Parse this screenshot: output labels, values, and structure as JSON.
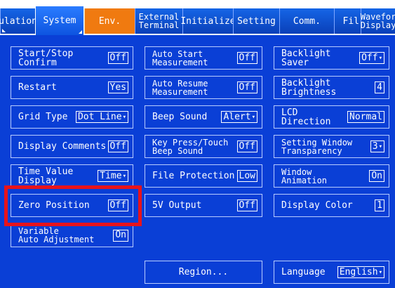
{
  "tabs": [
    {
      "label": "ulation",
      "state": "normal",
      "has_corner": true
    },
    {
      "label": "System",
      "state": "active",
      "has_corner": true
    },
    {
      "label": "Env.",
      "state": "orange",
      "has_corner": false
    },
    {
      "label": "External\nTerminal",
      "state": "normal",
      "has_corner": false
    },
    {
      "label": "Initialize",
      "state": "normal",
      "has_corner": false
    },
    {
      "label": "Setting",
      "state": "normal",
      "has_corner": false
    },
    {
      "label": "Comm.",
      "state": "normal",
      "has_corner": false
    },
    {
      "label": "Fil",
      "state": "normal",
      "has_corner": false
    },
    {
      "label": "Wavefor\nDisplay",
      "state": "normal",
      "has_corner": false
    }
  ],
  "col1": [
    {
      "label": "Start/Stop Confirm",
      "value": "Off",
      "dropdown": false
    },
    {
      "label": "Restart",
      "value": "Yes",
      "dropdown": false
    },
    {
      "label": "Grid Type",
      "value": "Dot Line",
      "dropdown": true
    },
    {
      "label": "Display Comments",
      "value": "Off",
      "dropdown": false
    },
    {
      "label": "Time Value Display",
      "value": "Time",
      "dropdown": true
    },
    {
      "label": "Zero Position",
      "value": "Off",
      "dropdown": false
    },
    {
      "label": "Variable\nAuto Adjustment",
      "value": "On",
      "dropdown": false
    }
  ],
  "col2": [
    {
      "label": "Auto Start\nMeasurement",
      "value": "Off",
      "dropdown": false
    },
    {
      "label": "Auto Resume\nMeasurement",
      "value": "Off",
      "dropdown": false
    },
    {
      "label": "Beep Sound",
      "value": "Alert",
      "dropdown": true
    },
    {
      "label": "Key Press/Touch\nBeep Sound",
      "value": "Off",
      "dropdown": false
    },
    {
      "label": "File Protection",
      "value": "Low",
      "dropdown": false
    },
    {
      "label": "5V Output",
      "value": "Off",
      "dropdown": false
    }
  ],
  "col3": [
    {
      "label": "Backlight Saver",
      "value": "Off",
      "dropdown": true
    },
    {
      "label": "Backlight Brightness",
      "value": "4",
      "dropdown": false
    },
    {
      "label": "LCD Direction",
      "value": "Normal",
      "dropdown": false
    },
    {
      "label": "Setting Window\nTransparency",
      "value": "3",
      "dropdown": true
    },
    {
      "label": "Window\nAnimation",
      "value": "On",
      "dropdown": false
    },
    {
      "label": "Display Color",
      "value": "1",
      "dropdown": false
    }
  ],
  "region_button": "Region...",
  "language": {
    "label": "Language",
    "value": "English",
    "dropdown": true
  }
}
